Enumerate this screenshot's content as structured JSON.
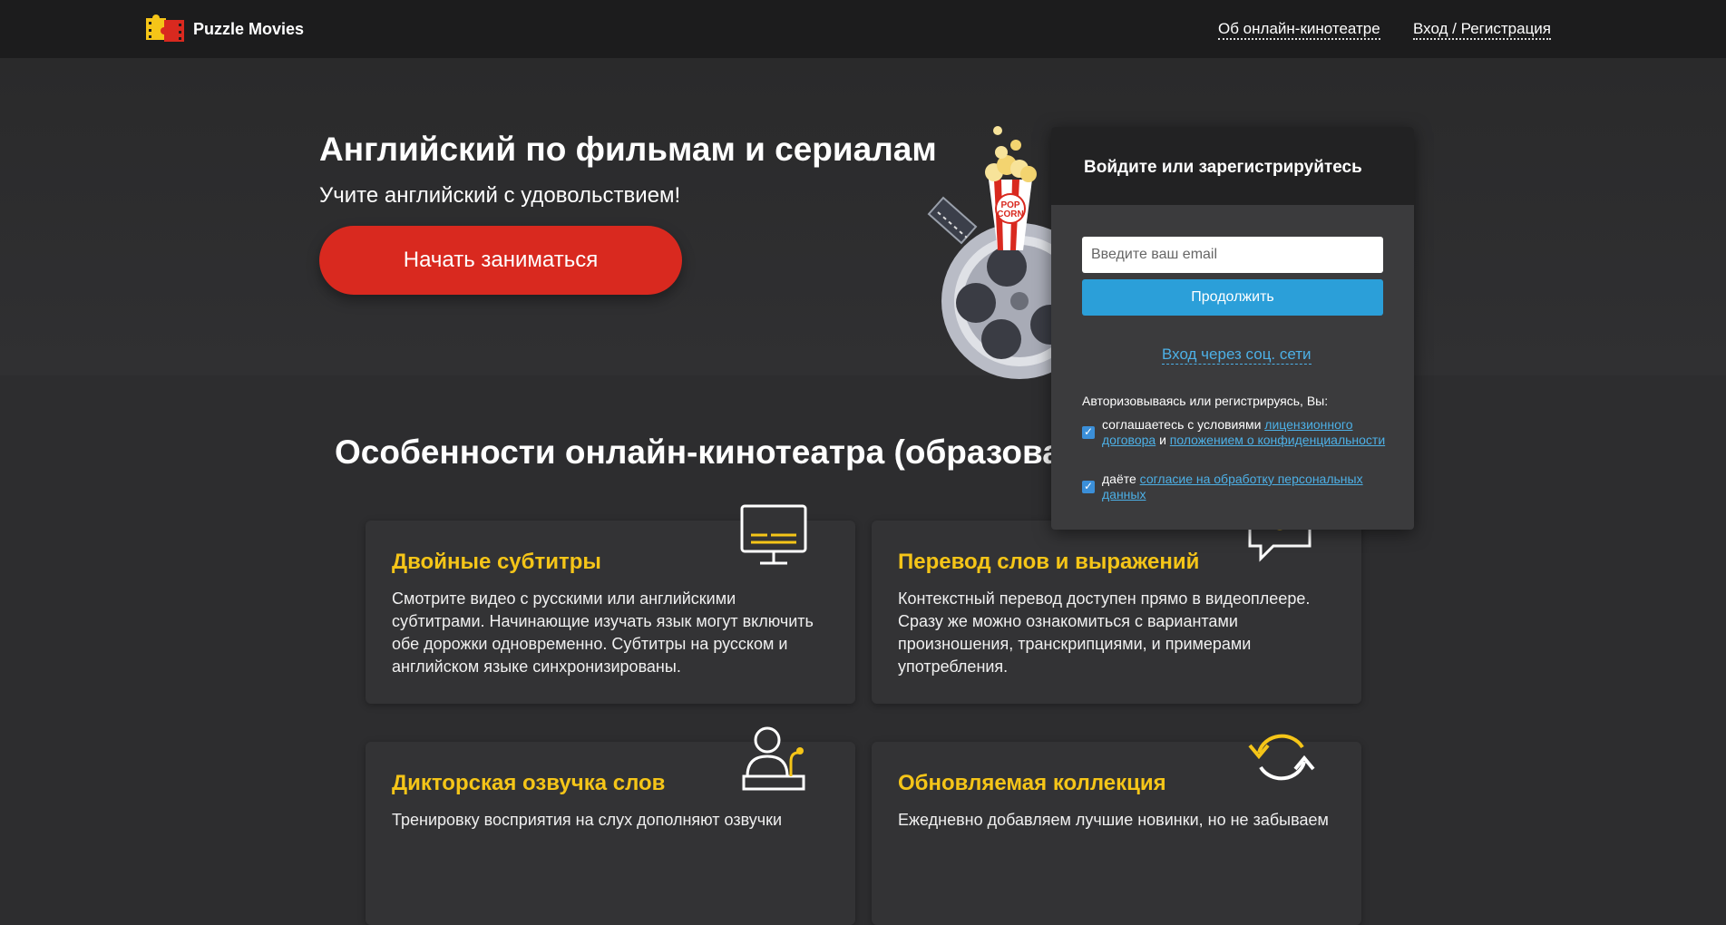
{
  "header": {
    "brand": "Puzzle Movies",
    "nav_about": "Об онлайн-кинотеатре",
    "nav_login": "Вход / Регистрация"
  },
  "hero": {
    "title": "Английский по фильмам и сериалам",
    "subtitle": "Учите английский с удовольствием!",
    "cta": "Начать заниматься"
  },
  "features": {
    "title": "Особенности онлайн-кинотеатра (образовате",
    "cards": [
      {
        "title": "Двойные субтитры",
        "text": "Смотрите видео с русскими или английскими субтитрами. Начинающие изучать язык могут включить обе дорожки одновременно. Субтитры на русском и английском языке синхронизированы."
      },
      {
        "title": "Перевод слов и выражений",
        "text": "Контекстный перевод доступен прямо в видеоплеере. Сразу же можно ознакомиться с вариантами произношения, транскрипциями, и примерами употребления."
      },
      {
        "title": "Дикторская озвучка слов",
        "text": "Тренировку восприятия на слух дополняют озвучки"
      },
      {
        "title": "Обновляемая коллекция",
        "text": "Ежедневно добавляем лучшие новинки, но не забываем"
      }
    ]
  },
  "auth": {
    "heading": "Войдите или зарегистрируйтесь",
    "email_placeholder": "Введите ваш email",
    "continue": "Продолжить",
    "social": "Вход через соц. сети",
    "consent_intro": "Авторизовываясь или регистрируясь, Вы:",
    "consent1_prefix": "соглашаетесь с условиями ",
    "consent1_link1": "лицензионного договора",
    "consent1_mid": " и ",
    "consent1_link2": "положением о конфиденциальности",
    "consent2_prefix": "даёте ",
    "consent2_link": "согласие на обработку персональных данных"
  },
  "art": {
    "popcorn_label_1": "POP",
    "popcorn_label_2": "CORN"
  },
  "colors": {
    "accent_red": "#d9291f",
    "accent_blue": "#2b9fd9",
    "accent_yellow": "#f5c518",
    "link_blue": "#4db0e6"
  }
}
